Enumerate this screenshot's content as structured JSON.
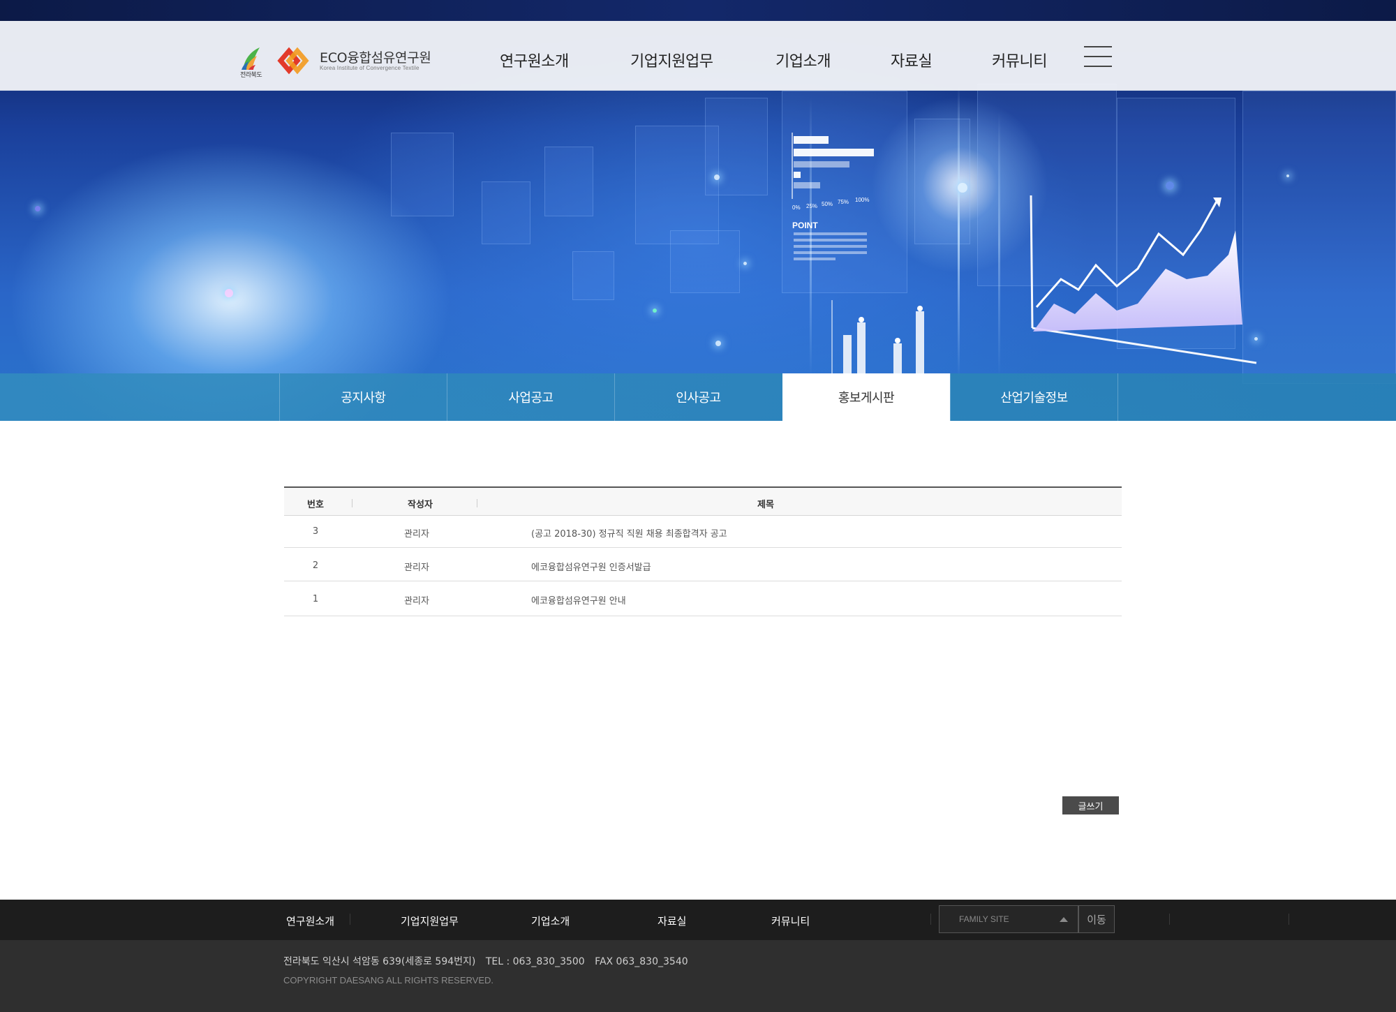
{
  "header": {
    "logo_region": "전라북도",
    "logo_title": "ECO융합섬유연구원",
    "logo_subtitle": "Korea Institute of Convergence Textile",
    "nav": [
      "연구원소개",
      "기업지원업무",
      "기업소개",
      "자료실",
      "커뮤니티"
    ]
  },
  "hero": {
    "chart_label": "POINT",
    "chart_ticks": [
      "0%",
      "25%",
      "50%",
      "75%",
      "100%"
    ]
  },
  "subtabs": {
    "items": [
      "공지사항",
      "사업공고",
      "인사공고",
      "홍보게시판",
      "산업기술정보"
    ],
    "active": "홍보게시판"
  },
  "board": {
    "columns": [
      "번호",
      "작성자",
      "제목"
    ],
    "rows": [
      {
        "num": "3",
        "author": "관리자",
        "title": "(공고 2018-30) 정규직 직원 채용 최종합격자 공고"
      },
      {
        "num": "2",
        "author": "관리자",
        "title": "에코융합섬유연구원 인증서발급"
      },
      {
        "num": "1",
        "author": "관리자",
        "title": "에코융합섬유연구원 안내"
      }
    ],
    "write_label": "글쓰기"
  },
  "footer": {
    "nav": [
      "연구원소개",
      "기업지원업무",
      "기업소개",
      "자료실",
      "커뮤니티"
    ],
    "family_site": "FAMILY SITE",
    "go_label": "이동",
    "address": "전라북도 익산시 석암동 639(세종로 594번지)",
    "tel": "TEL : 063_830_3500",
    "fax": "FAX  063_830_3540",
    "copyright": "COPYRIGHT DAESANG ALL RIGHTS RESERVED."
  },
  "colors": {
    "header_bg": "#eef1f6",
    "subtab_bg": "#3a8dbd",
    "footer_nav_bg": "#1d1d1d",
    "footer_info_bg": "#2f2f2f",
    "write_button": "#4b4b4b"
  }
}
